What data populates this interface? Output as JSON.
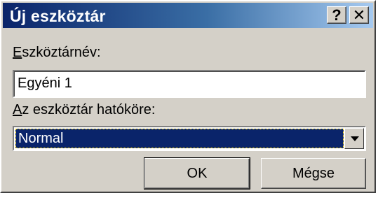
{
  "dialog": {
    "title": "Új eszköztár",
    "help_glyph": "?",
    "close_glyph": "✕"
  },
  "toolbar_name": {
    "label_mnemonic": "E",
    "label_rest": "szköztárnév:",
    "value": "Egyéni 1"
  },
  "scope": {
    "label_mnemonic": "A",
    "label_rest": "z eszköztár hatóköre:",
    "selected": "Normal"
  },
  "buttons": {
    "ok": "OK",
    "cancel": "Mégse"
  },
  "colors": {
    "title_bar": "#0a246a",
    "dialog_face": "#d4d0c8",
    "selection": "#0a246a"
  }
}
